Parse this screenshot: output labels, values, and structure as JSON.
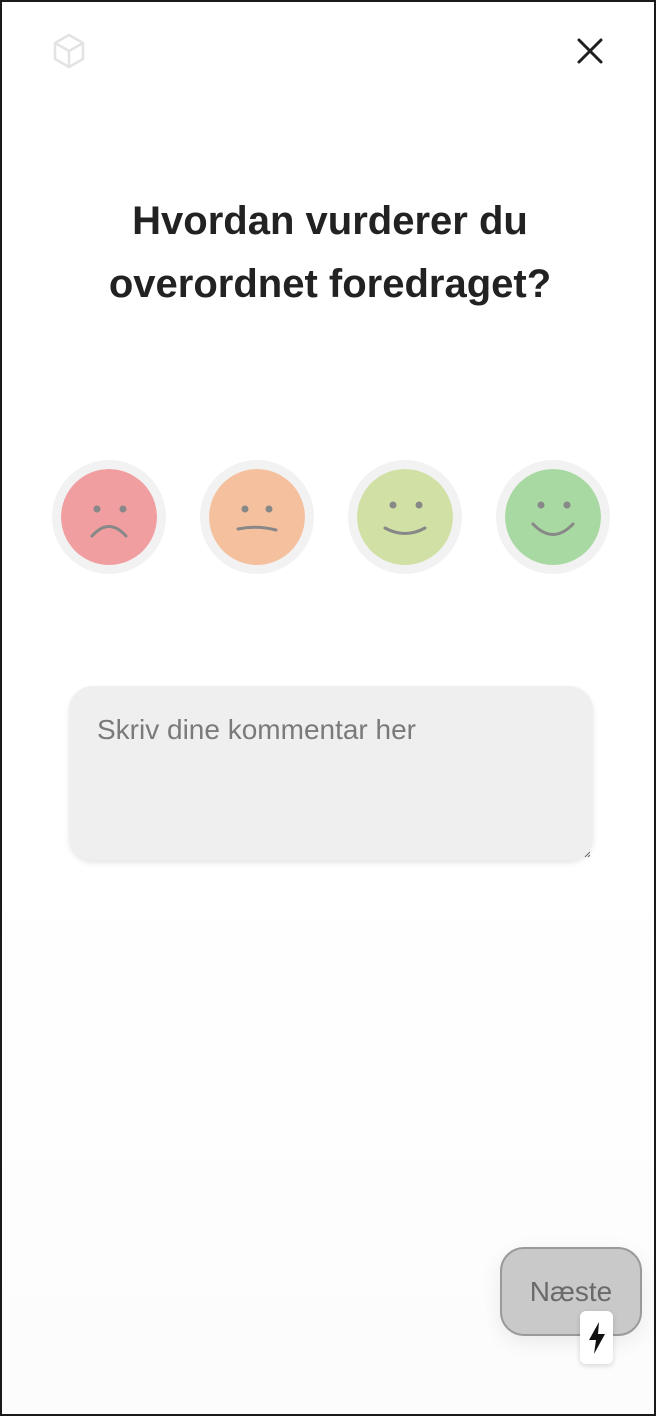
{
  "header": {
    "logo_icon": "cube-icon",
    "close_icon": "close-icon"
  },
  "question": {
    "title": "Hvordan vurderer du overordnet foredraget?"
  },
  "ratings": [
    {
      "icon": "sad-face-icon",
      "color": "#f09e9f"
    },
    {
      "icon": "neutral-face-icon",
      "color": "#f5c09e"
    },
    {
      "icon": "slight-smile-face-icon",
      "color": "#d1e0a4"
    },
    {
      "icon": "happy-face-icon",
      "color": "#a9d9a2"
    }
  ],
  "comment": {
    "placeholder": "Skriv dine kommentar her",
    "value": ""
  },
  "footer": {
    "next_label": "Næste",
    "badge_icon": "lightning-bolt-icon"
  },
  "colors": {
    "title": "#222222",
    "next_bg": "#c9c9c9",
    "input_bg": "#efefef"
  }
}
